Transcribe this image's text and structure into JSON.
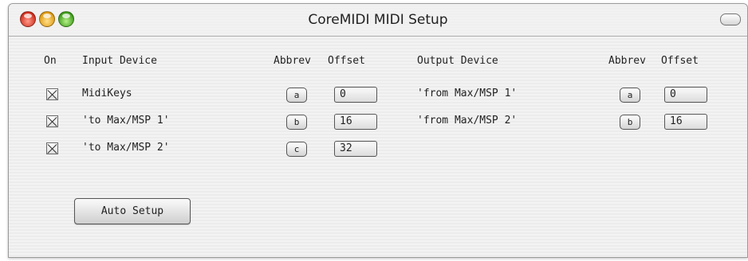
{
  "window": {
    "title": "CoreMIDI MIDI Setup"
  },
  "headers": {
    "on": "On",
    "input_device": "Input Device",
    "abbrev_in": "Abbrev",
    "offset_in": "Offset",
    "output_device": "Output Device",
    "abbrev_out": "Abbrev",
    "offset_out": "Offset"
  },
  "inputs": [
    {
      "on": true,
      "device": "MidiKeys",
      "abbrev": "a",
      "offset": "0"
    },
    {
      "on": true,
      "device": "'to Max/MSP 1'",
      "abbrev": "b",
      "offset": "16"
    },
    {
      "on": true,
      "device": "'to Max/MSP 2'",
      "abbrev": "c",
      "offset": "32"
    }
  ],
  "outputs": [
    {
      "device": "'from Max/MSP 1'",
      "abbrev": "a",
      "offset": "0"
    },
    {
      "device": "'from Max/MSP 2'",
      "abbrev": "b",
      "offset": "16"
    }
  ],
  "buttons": {
    "auto_setup": "Auto Setup"
  },
  "icons": {
    "close": "close-icon",
    "minimize": "minimize-icon",
    "zoom": "zoom-icon",
    "toolbar_toggle": "toolbar-toggle-icon",
    "checkbox": "checkbox-checked-icon"
  },
  "colors": {
    "close": "#d0301f",
    "minimize": "#e09b12",
    "zoom": "#3f9d1b"
  }
}
